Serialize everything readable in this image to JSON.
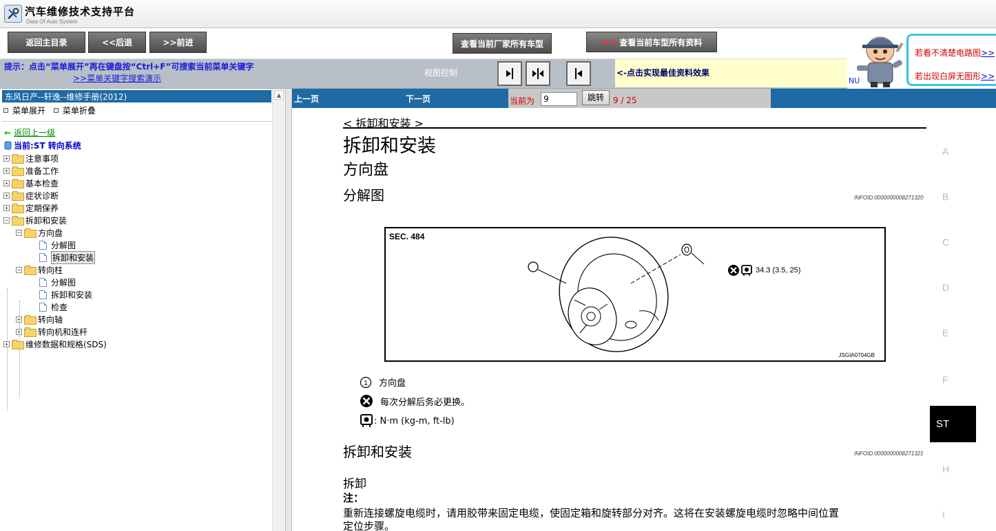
{
  "app": {
    "title": "汽车维修技术支持平台",
    "subtitle": "Data Of Auto System"
  },
  "toolbar": {
    "home": "返回主目录",
    "back": "<<后退",
    "forward": ">>前进",
    "maker_models": "查看当前厂家所有车型",
    "model_prefix": ">>",
    "model_all": "查看当前车型所有资料"
  },
  "banner": {
    "line1": "若看不清楚电路图",
    "line1_link": ">>",
    "line2": "若出现白屏无图形",
    "line2_link": ">>",
    "nu": "NU"
  },
  "hint": {
    "text": "提示：点击“菜单展开”再在键盘按“Ctrl+F”可搜索当前菜单关键字",
    "demo": ">>菜单关键字搜索演示",
    "view_control": "视图控制",
    "best_effect": "<-点击实现最佳资料效果"
  },
  "left": {
    "manual_title": "东风日产--轩逸--维修手册(2012)",
    "expand": "菜单展开",
    "collapse": "菜单折叠",
    "back_up": "返回上一级",
    "current": "当前:ST 转向系统",
    "tree": [
      {
        "label": "注意事项"
      },
      {
        "label": "准备工作"
      },
      {
        "label": "基本检查"
      },
      {
        "label": "症状诊断"
      },
      {
        "label": "定期保养"
      },
      {
        "label": "拆卸和安装"
      },
      {
        "label": "方向盘"
      },
      {
        "label": "分解图"
      },
      {
        "label": "拆卸和安装"
      },
      {
        "label": "转向柱"
      },
      {
        "label": "分解图"
      },
      {
        "label": "拆卸和安装"
      },
      {
        "label": "检查"
      },
      {
        "label": "转向轴"
      },
      {
        "label": "转向机和连杆"
      },
      {
        "label": "维修数据和规格(SDS)"
      }
    ]
  },
  "nav": {
    "prev": "上一页",
    "next": "下一页",
    "current_label": "当前为",
    "page_value": "9",
    "jump": "跳转",
    "page_count": "9 / 25"
  },
  "doc": {
    "crumb": "< 拆卸和安装 >",
    "heading": "拆卸和安装",
    "subheading": "方向盘",
    "section1": "分解图",
    "infoid1": "INFOID:0000000008271320",
    "figure": {
      "sec": "SEC. 484",
      "callout": "1",
      "torque": "34.3 (3.5, 25)",
      "code": "JSGIA0704GB"
    },
    "legend": [
      {
        "text": "方向盘"
      },
      {
        "text": "每次分解后务必更换。"
      },
      {
        "text": ": N·m (kg-m, ft-lb)"
      }
    ],
    "section2": "拆卸和安装",
    "infoid2": "INFOID:0000000008271321",
    "removal": "拆卸",
    "note": "注：",
    "paragraph": "重新连接螺旋电缆时，请用胶带来固定电缆，使固定箱和旋转部分对齐。这将在安装螺旋电缆时忽略中间位置",
    "paragraph2": "定位步骤。"
  },
  "section_index": {
    "letters": [
      "A",
      "B",
      "C",
      "D",
      "E",
      "F",
      "H",
      "I"
    ],
    "active": "ST"
  },
  "colors": {
    "nav_blue": "#1e6aa5",
    "hint_blue": "#1a1adc",
    "alert_red": "#d40000",
    "hint_bg": "#b8bfc7",
    "banner_cyan": "#3ec0e8"
  }
}
